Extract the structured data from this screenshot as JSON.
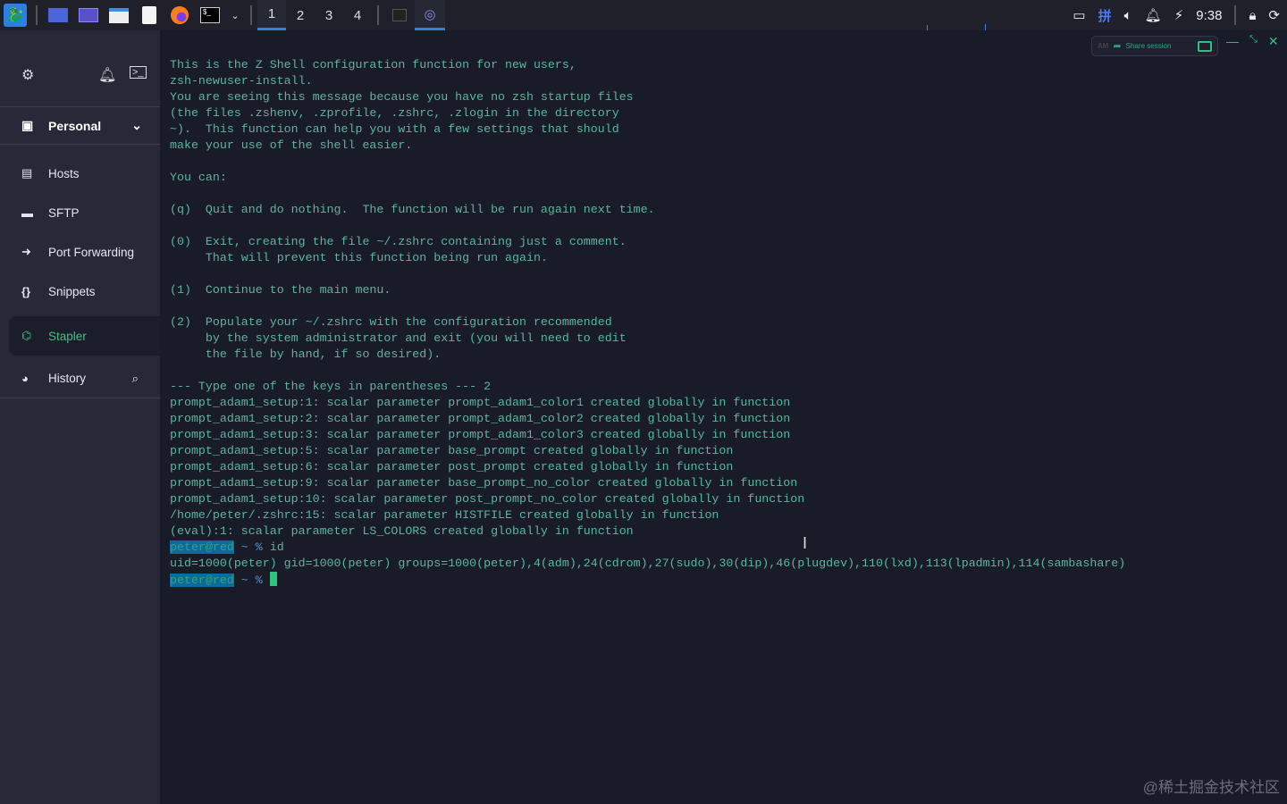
{
  "taskbar": {
    "workspaces": [
      "1",
      "2",
      "3",
      "4"
    ],
    "active_workspace": "1",
    "clock": "9:38",
    "input_method": "拼"
  },
  "sidebar": {
    "vault": "Personal",
    "items": [
      {
        "label": "Hosts",
        "icon": "hosts-icon"
      },
      {
        "label": "SFTP",
        "icon": "folder-icon"
      },
      {
        "label": "Port Forwarding",
        "icon": "arrow-icon"
      },
      {
        "label": "Snippets",
        "icon": "braces-icon"
      },
      {
        "label": "Stapler",
        "icon": "stapler-icon"
      },
      {
        "label": "History",
        "icon": "clock-icon"
      }
    ]
  },
  "header": {
    "share_label": "Share session",
    "badge": "AM"
  },
  "terminal": {
    "lines": [
      "This is the Z Shell configuration function for new users,",
      "zsh-newuser-install.",
      "You are seeing this message because you have no zsh startup files",
      "(the files .zshenv, .zprofile, .zshrc, .zlogin in the directory",
      "~).  This function can help you with a few settings that should",
      "make your use of the shell easier.",
      "",
      "You can:",
      "",
      "(q)  Quit and do nothing.  The function will be run again next time.",
      "",
      "(0)  Exit, creating the file ~/.zshrc containing just a comment.",
      "     That will prevent this function being run again.",
      "",
      "(1)  Continue to the main menu.",
      "",
      "(2)  Populate your ~/.zshrc with the configuration recommended",
      "     by the system administrator and exit (you will need to edit",
      "     the file by hand, if so desired).",
      "",
      "--- Type one of the keys in parentheses --- 2",
      "prompt_adam1_setup:1: scalar parameter prompt_adam1_color1 created globally in function",
      "prompt_adam1_setup:2: scalar parameter prompt_adam1_color2 created globally in function",
      "prompt_adam1_setup:3: scalar parameter prompt_adam1_color3 created globally in function",
      "prompt_adam1_setup:5: scalar parameter base_prompt created globally in function",
      "prompt_adam1_setup:6: scalar parameter post_prompt created globally in function",
      "prompt_adam1_setup:9: scalar parameter base_prompt_no_color created globally in function",
      "prompt_adam1_setup:10: scalar parameter post_prompt_no_color created globally in function",
      "/home/peter/.zshrc:15: scalar parameter HISTFILE created globally in function",
      "(eval):1: scalar parameter LS_COLORS created globally in function"
    ],
    "prompt_user": "peter@red",
    "prompt_rest": " ~ % ",
    "command": "id",
    "output": "uid=1000(peter) gid=1000(peter) groups=1000(peter),4(adm),24(cdrom),27(sudo),30(dip),46(plugdev),110(lxd),113(lpadmin),114(sambashare)"
  },
  "watermark": "@稀土掘金技术社区"
}
